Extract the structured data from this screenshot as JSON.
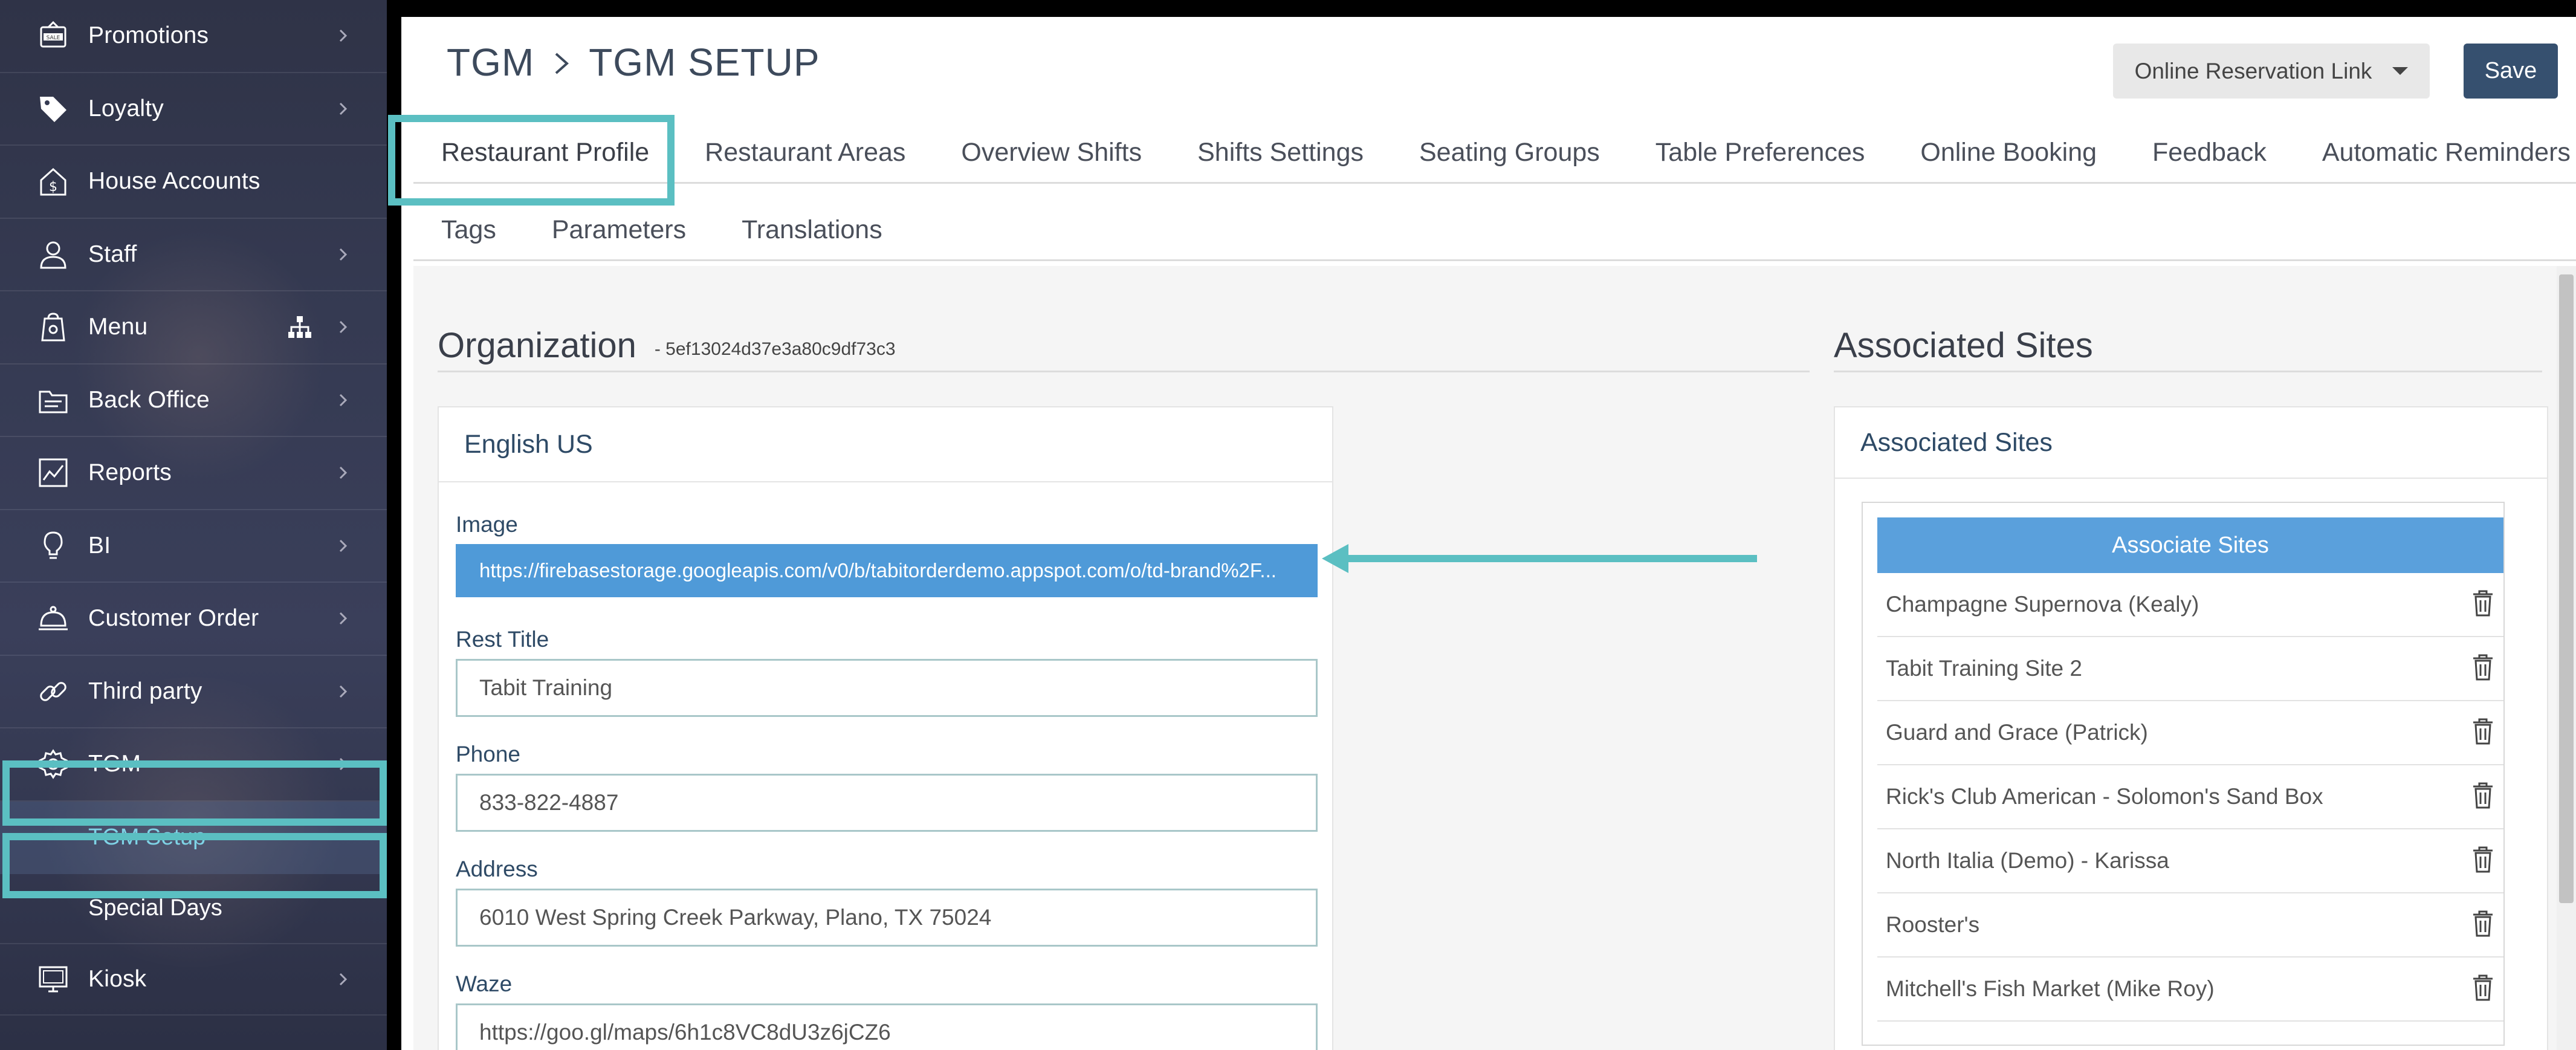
{
  "sidebar": {
    "items": [
      {
        "label": "Promotions",
        "icon": "sale-tag-icon"
      },
      {
        "label": "Loyalty",
        "icon": "tag-icon"
      },
      {
        "label": "House Accounts",
        "icon": "house-dollar-icon"
      },
      {
        "label": "Staff",
        "icon": "user-icon"
      },
      {
        "label": "Menu",
        "icon": "menu-bag-icon"
      },
      {
        "label": "Back Office",
        "icon": "folder-icon"
      },
      {
        "label": "Reports",
        "icon": "chart-icon"
      },
      {
        "label": "BI",
        "icon": "lightbulb-icon"
      },
      {
        "label": "Customer Order",
        "icon": "cloche-icon"
      },
      {
        "label": "Third party",
        "icon": "link-icon"
      },
      {
        "label": "TGM",
        "icon": "gear-icon"
      }
    ],
    "sub_items": [
      {
        "label": "TGM Setup",
        "active": true
      },
      {
        "label": "Special Days",
        "active": false
      }
    ],
    "last_item": {
      "label": "Kiosk",
      "icon": "kiosk-icon"
    }
  },
  "header": {
    "breadcrumb_root": "TGM",
    "breadcrumb_page": "TGM SETUP",
    "reservation_link_label": "Online Reservation Link",
    "save_label": "Save"
  },
  "tabs_row1": [
    {
      "label": "Restaurant Profile",
      "active": true
    },
    {
      "label": "Restaurant Areas"
    },
    {
      "label": "Overview Shifts"
    },
    {
      "label": "Shifts Settings"
    },
    {
      "label": "Seating Groups"
    },
    {
      "label": "Table Preferences"
    },
    {
      "label": "Online Booking"
    },
    {
      "label": "Feedback"
    },
    {
      "label": "Automatic Reminders"
    }
  ],
  "tabs_row2": [
    {
      "label": "Tags"
    },
    {
      "label": "Parameters"
    },
    {
      "label": "Translations"
    }
  ],
  "organization": {
    "title": "Organization",
    "id": "- 5ef13024d37e3a80c9df73c3",
    "language_card_title": "English US",
    "fields": {
      "image": {
        "label": "Image",
        "value": "https://firebasestorage.googleapis.com/v0/b/tabitorderdemo.appspot.com/o/td-brand%2F..."
      },
      "rest_title": {
        "label": "Rest Title",
        "value": "Tabit Training"
      },
      "phone": {
        "label": "Phone",
        "value": "833-822-4887"
      },
      "address": {
        "label": "Address",
        "value": "6010 West Spring Creek Parkway, Plano, TX 75024"
      },
      "waze": {
        "label": "Waze",
        "value": "https://goo.gl/maps/6h1c8VC8dU3z6jCZ6"
      }
    }
  },
  "associated_sites": {
    "section_title": "Associated Sites",
    "card_title": "Associated Sites",
    "associate_button": "Associate Sites",
    "sites": [
      "Champagne Supernova (Kealy)",
      "Tabit Training Site 2",
      "Guard and Grace (Patrick)",
      "Rick's Club American - Solomon's Sand Box",
      "North Italia (Demo) - Karissa",
      "Rooster's",
      "Mitchell's Fish Market (Mike Roy)"
    ]
  },
  "colors": {
    "highlight": "#5bbfc2",
    "save_button": "#36506f",
    "primary_blue": "#5aa0dc",
    "label_navy": "#2e4a66"
  }
}
